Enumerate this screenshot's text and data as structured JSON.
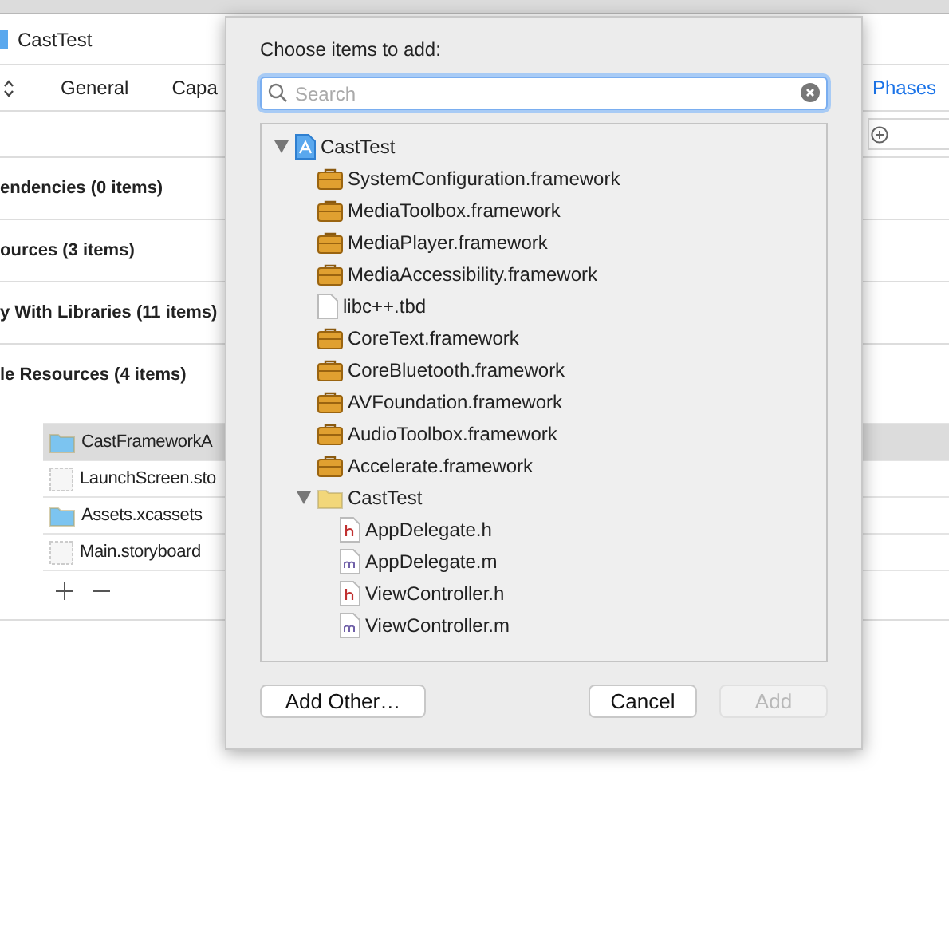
{
  "window": {
    "title": "CastTest"
  },
  "tabs": [
    {
      "label": "General",
      "selected": false
    },
    {
      "label": "Capa",
      "selected": false
    },
    {
      "label": "Phases",
      "selected": true
    }
  ],
  "sections": [
    {
      "title": "endencies (0 items)"
    },
    {
      "title": "ources (3 items)"
    },
    {
      "title": "y With Libraries (11 items)"
    },
    {
      "title": "le Resources (4 items)"
    }
  ],
  "resources": [
    {
      "name": "CastFrameworkA",
      "kind": "folder",
      "selected": true
    },
    {
      "name": "LaunchScreen.sto",
      "kind": "storyboard",
      "selected": false
    },
    {
      "name": "Assets.xcassets",
      "kind": "folder",
      "selected": false
    },
    {
      "name": "Main.storyboard",
      "kind": "storyboard",
      "selected": false
    }
  ],
  "sheet": {
    "prompt": "Choose items to add:",
    "search": {
      "placeholder": "Search"
    },
    "tree": [
      {
        "label": "CastTest",
        "kind": "project",
        "expanded": true,
        "children": [
          {
            "label": "SystemConfiguration.framework",
            "kind": "framework"
          },
          {
            "label": "MediaToolbox.framework",
            "kind": "framework"
          },
          {
            "label": "MediaPlayer.framework",
            "kind": "framework"
          },
          {
            "label": "MediaAccessibility.framework",
            "kind": "framework"
          },
          {
            "label": "libc++.tbd",
            "kind": "file"
          },
          {
            "label": "CoreText.framework",
            "kind": "framework"
          },
          {
            "label": "CoreBluetooth.framework",
            "kind": "framework"
          },
          {
            "label": "AVFoundation.framework",
            "kind": "framework"
          },
          {
            "label": "AudioToolbox.framework",
            "kind": "framework"
          },
          {
            "label": "Accelerate.framework",
            "kind": "framework"
          },
          {
            "label": "CastTest",
            "kind": "folder",
            "expanded": true,
            "children": [
              {
                "label": "AppDelegate.h",
                "kind": "header"
              },
              {
                "label": "AppDelegate.m",
                "kind": "source"
              },
              {
                "label": "ViewController.h",
                "kind": "header"
              },
              {
                "label": "ViewController.m",
                "kind": "source"
              }
            ]
          }
        ]
      }
    ],
    "buttons": [
      {
        "label": "Add Other…",
        "disabled": false
      },
      {
        "label": "Cancel",
        "disabled": false
      },
      {
        "label": "Add",
        "disabled": true
      }
    ]
  }
}
